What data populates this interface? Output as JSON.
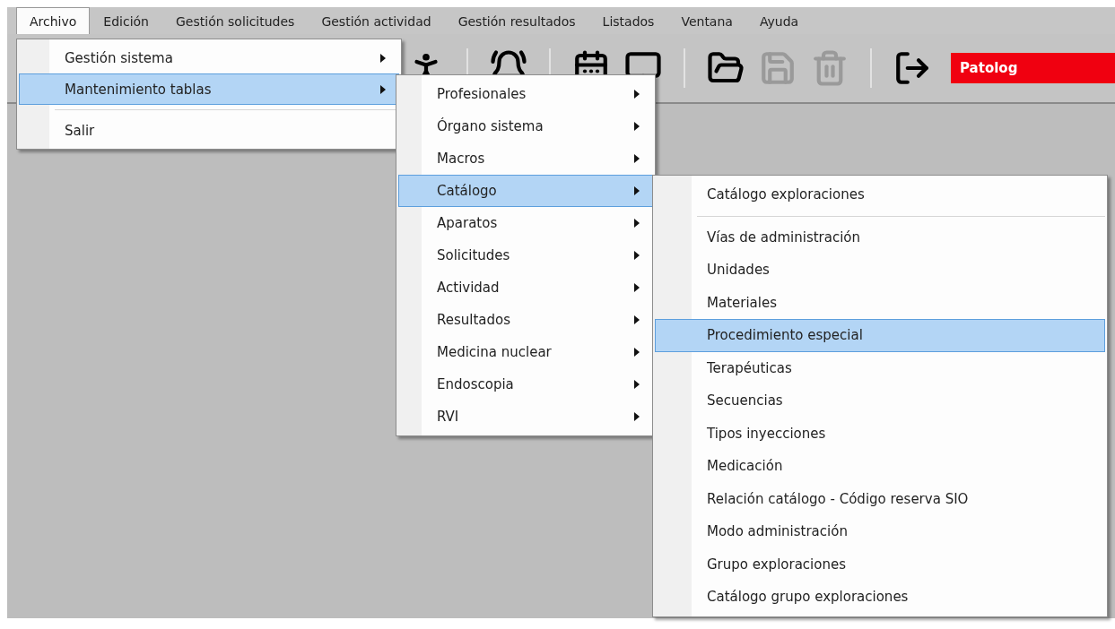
{
  "menu_bar": [
    {
      "label": "Archivo",
      "selected": true
    },
    {
      "label": "Edición",
      "selected": false
    },
    {
      "label": "Gestión solicitudes",
      "selected": false
    },
    {
      "label": "Gestión actividad",
      "selected": false
    },
    {
      "label": "Gestión resultados",
      "selected": false
    },
    {
      "label": "Listados",
      "selected": false
    },
    {
      "label": "Ventana",
      "selected": false
    },
    {
      "label": "Ayuda",
      "selected": false
    }
  ],
  "toolbar": [
    {
      "kind": "person",
      "disabled": false
    },
    {
      "kind": "separator"
    },
    {
      "kind": "bell",
      "disabled": false
    },
    {
      "kind": "separator"
    },
    {
      "kind": "calendar",
      "disabled": false
    },
    {
      "kind": "monitor",
      "disabled": false
    },
    {
      "kind": "separator"
    },
    {
      "kind": "folder",
      "disabled": false
    },
    {
      "kind": "save",
      "disabled": true
    },
    {
      "kind": "trash",
      "disabled": true
    },
    {
      "kind": "separator"
    },
    {
      "kind": "exit",
      "disabled": false
    },
    {
      "kind": "badge",
      "label": "Patolog"
    }
  ],
  "menus": [
    {
      "items": [
        {
          "label": "Gestión sistema",
          "selected": false,
          "submenu": true
        },
        {
          "label": "Mantenimiento tablas",
          "selected": true,
          "submenu": true
        },
        {
          "kind": "separator"
        },
        {
          "label": "Salir",
          "selected": false,
          "submenu": false
        }
      ]
    },
    {
      "items": [
        {
          "label": "Profesionales",
          "selected": false,
          "submenu": true
        },
        {
          "label": "Órgano sistema",
          "selected": false,
          "submenu": true
        },
        {
          "label": "Macros",
          "selected": false,
          "submenu": true
        },
        {
          "label": "Catálogo",
          "selected": true,
          "submenu": true
        },
        {
          "label": "Aparatos",
          "selected": false,
          "submenu": true
        },
        {
          "label": "Solicitudes",
          "selected": false,
          "submenu": true
        },
        {
          "label": "Actividad",
          "selected": false,
          "submenu": true
        },
        {
          "label": "Resultados",
          "selected": false,
          "submenu": true
        },
        {
          "label": "Medicina nuclear",
          "selected": false,
          "submenu": true
        },
        {
          "label": "Endoscopia",
          "selected": false,
          "submenu": true
        },
        {
          "label": "RVI",
          "selected": false,
          "submenu": true
        }
      ]
    },
    {
      "items": [
        {
          "label": "Catálogo exploraciones",
          "selected": false,
          "submenu": false
        },
        {
          "kind": "separator"
        },
        {
          "label": "Vías de administración",
          "selected": false,
          "submenu": false
        },
        {
          "label": "Unidades",
          "selected": false,
          "submenu": false
        },
        {
          "label": "Materiales",
          "selected": false,
          "submenu": false
        },
        {
          "label": "Procedimiento especial",
          "selected": true,
          "submenu": false
        },
        {
          "label": "Terapéuticas",
          "selected": false,
          "submenu": false
        },
        {
          "label": "Secuencias",
          "selected": false,
          "submenu": false
        },
        {
          "label": "Tipos inyecciones",
          "selected": false,
          "submenu": false
        },
        {
          "label": "Medicación",
          "selected": false,
          "submenu": false
        },
        {
          "label": "Relación catálogo - Código reserva SIO",
          "selected": false,
          "submenu": false
        },
        {
          "label": "Modo administración",
          "selected": false,
          "submenu": false
        },
        {
          "label": "Grupo exploraciones",
          "selected": false,
          "submenu": false
        },
        {
          "label": "Catálogo grupo exploraciones",
          "selected": false,
          "submenu": false
        }
      ]
    }
  ]
}
